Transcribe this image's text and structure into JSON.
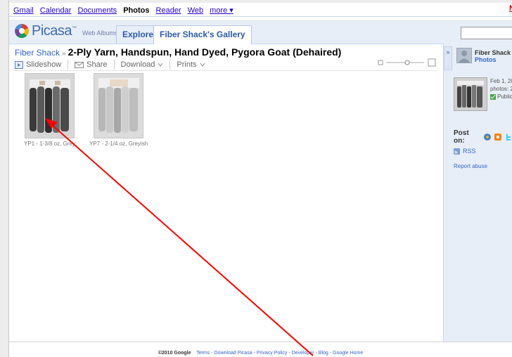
{
  "gbar": {
    "links": [
      "Gmail",
      "Calendar",
      "Documents"
    ],
    "current": "Photos",
    "links2": [
      "Reader",
      "Web",
      "more ▾"
    ],
    "new_label": "Ne"
  },
  "header": {
    "logo_text": "Picasa",
    "logo_tm": "™",
    "logo_sub": "Web Albums",
    "tabs": [
      "Explore",
      "Fiber Shack's Gallery"
    ]
  },
  "breadcrumb": {
    "owner": "Fiber Shack",
    "separator": "»",
    "title": "2-Ply Yarn, Handspun, Hand Dyed, Pygora Goat (Dehaired)"
  },
  "toolbar": {
    "slideshow": "Slideshow",
    "share": "Share",
    "download": "Download",
    "prints": "Prints"
  },
  "photos": [
    {
      "caption": "YP1 - 1-3/8 oz, Grey"
    },
    {
      "caption": "YP7 - 2-1/4 oz, Greyish"
    }
  ],
  "side": {
    "toggle": "»",
    "owner": "Fiber Shack",
    "photos_link": "Photos",
    "date": "Feb 1, 20",
    "photos_count": "photos: 2",
    "visibility": "Public",
    "post_on": "Post on:",
    "rss": "RSS",
    "report": "Report abuse"
  },
  "footer": {
    "copyright": "©2010 Google",
    "links": [
      "Terms",
      "Download Picasa",
      "Privacy Policy",
      "Developer",
      "Blog",
      "Google Home"
    ],
    "sep": " - "
  },
  "colors": {
    "link": "#3366cc",
    "arrow": "#ff0000",
    "header_bg": "#e8eef7"
  }
}
